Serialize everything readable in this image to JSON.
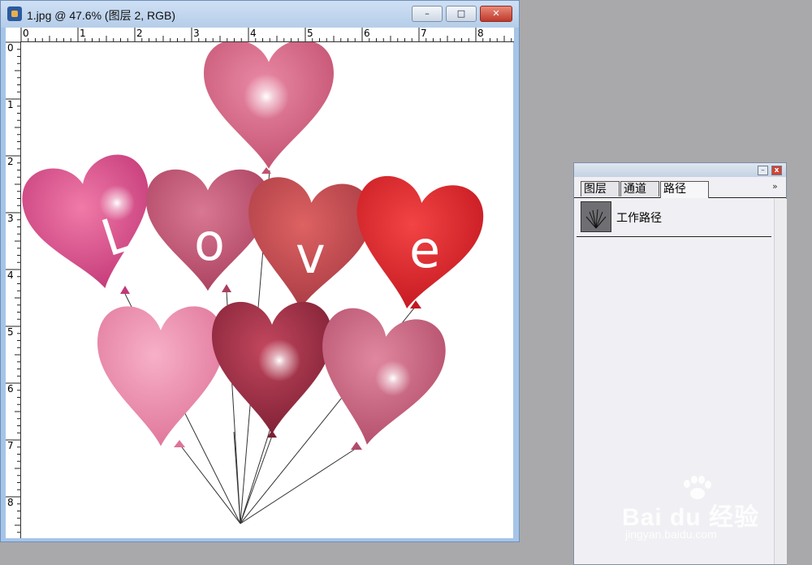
{
  "window": {
    "title": "1.jpg @ 47.6% (图层 2, RGB)",
    "min_label": "–",
    "max_label": "□",
    "close_label": "✕"
  },
  "rulers": {
    "h_labels": [
      "0",
      "1",
      "2",
      "3",
      "4",
      "5",
      "6",
      "7",
      "8"
    ],
    "v_labels": [
      "0",
      "1",
      "2",
      "3",
      "4",
      "5",
      "6",
      "7",
      "8"
    ]
  },
  "canvas": {
    "letters": [
      "L",
      "o",
      "v",
      "e"
    ]
  },
  "panel": {
    "tabs": [
      "图层",
      "通道",
      "路径"
    ],
    "more": "»",
    "min_label": "–",
    "close_label": "x",
    "path_name": "工作路径"
  },
  "watermark": {
    "main": "Bai du 经验",
    "sub": "jingyan.baidu.com"
  },
  "colors": {
    "window_frame": "#a6c4e8",
    "workspace": "#a9a9ab",
    "close_red": "#c0392b"
  }
}
